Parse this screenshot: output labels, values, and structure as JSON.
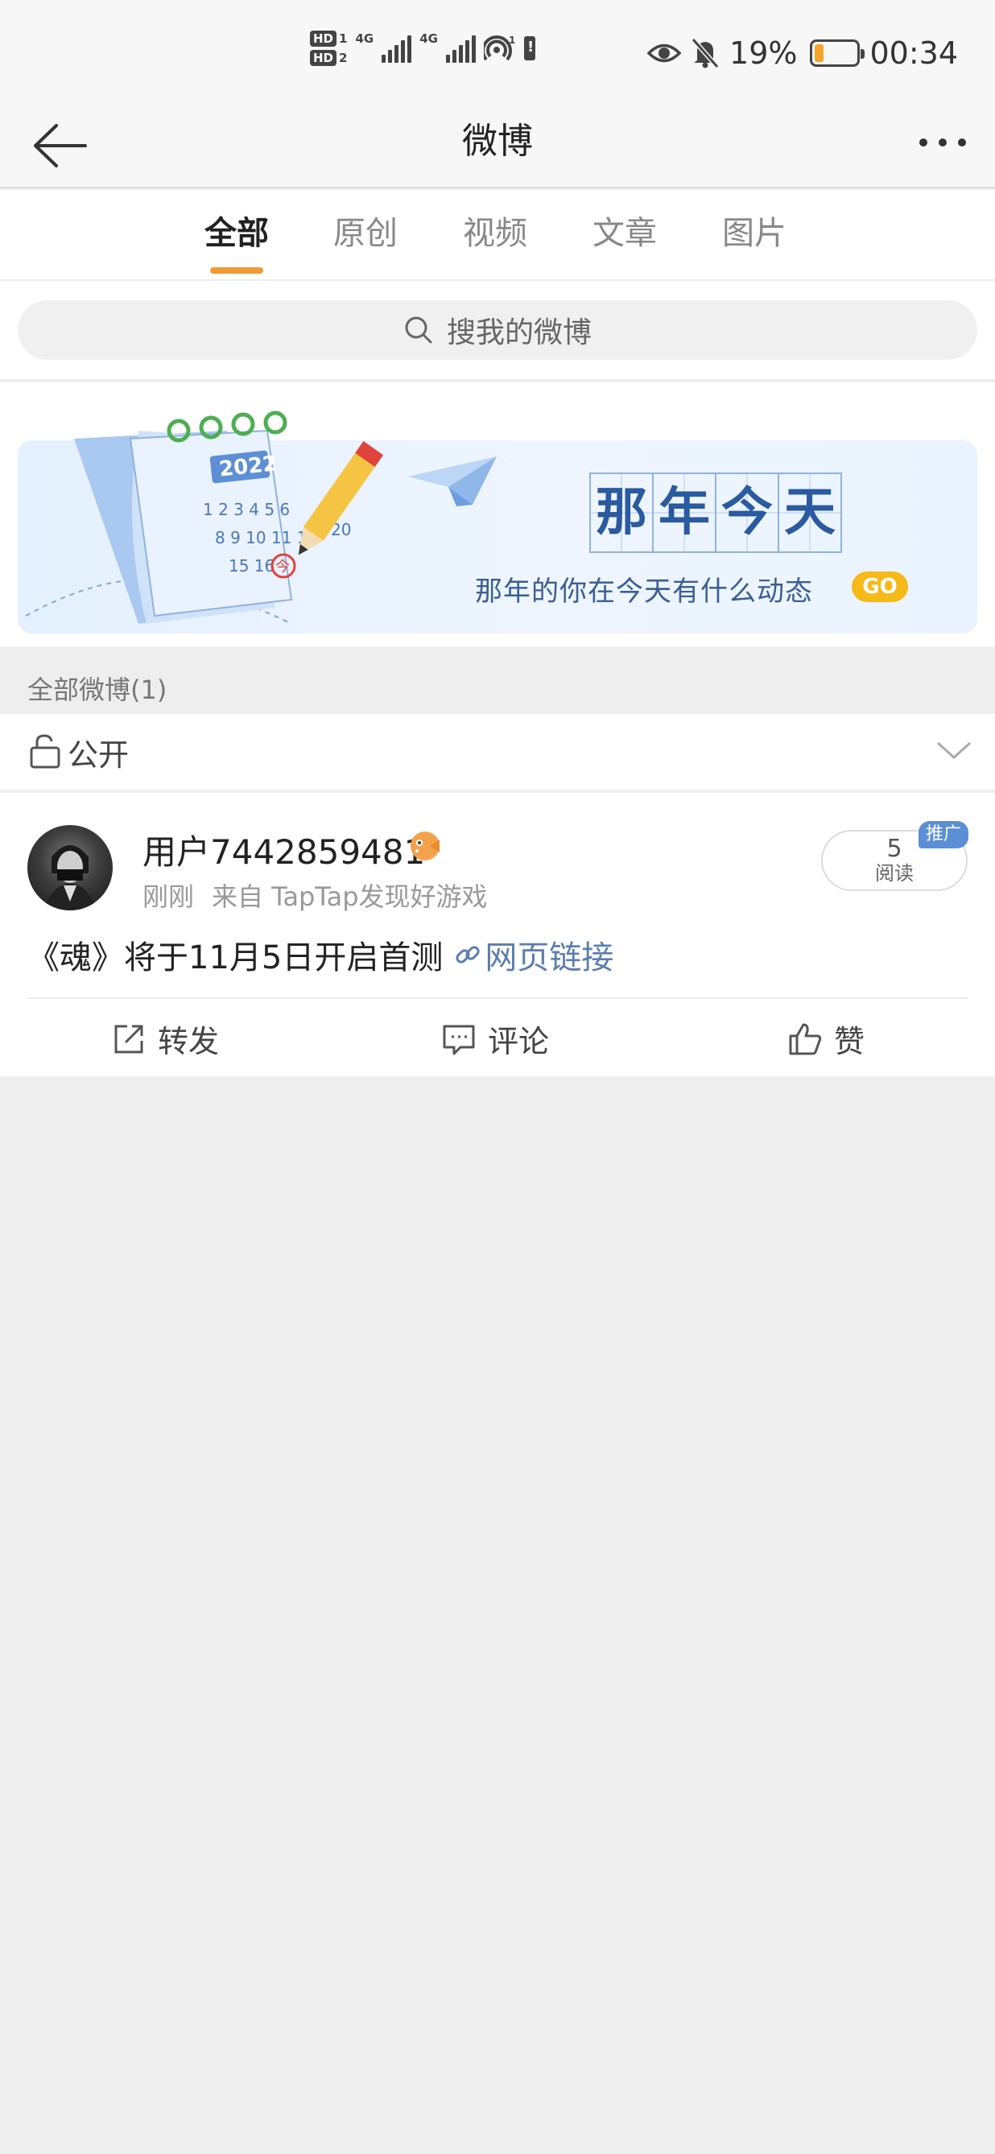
{
  "status_bar": {
    "sim1_label": "HD",
    "sim1_num": "1",
    "sim2_label": "HD",
    "sim2_num": "2",
    "net1": "4G",
    "net2": "4G",
    "wifi_badge": "1",
    "battery_percent": "19%",
    "time": "00:34",
    "battery_level": 0.19
  },
  "nav": {
    "title": "微博"
  },
  "tabs": [
    {
      "label": "全部",
      "active": true
    },
    {
      "label": "原创",
      "active": false
    },
    {
      "label": "视频",
      "active": false
    },
    {
      "label": "文章",
      "active": false
    },
    {
      "label": "图片",
      "active": false
    }
  ],
  "search": {
    "placeholder": "搜我的微博"
  },
  "banner": {
    "title_chars": [
      "那",
      "年",
      "今",
      "天"
    ],
    "subtitle": "那年的你在今天有什么动态",
    "go_label": "GO",
    "calendar_year": "2022",
    "calendar_today": "今"
  },
  "section": {
    "label": "全部微博(1)"
  },
  "visibility": {
    "label": "公开"
  },
  "post": {
    "username": "用户7442859481",
    "time": "刚刚",
    "source": "来自 TapTap发现好游戏",
    "read_count": "5",
    "read_label": "阅读",
    "promo_badge": "推广",
    "text": "《魂》将于11月5日开启首测",
    "link_text": "网页链接",
    "actions": {
      "repost": "转发",
      "comment": "评论",
      "like": "赞"
    }
  },
  "colors": {
    "accent": "#f09a37",
    "link": "#5b7eaf",
    "promo": "#5a8fd6",
    "go_button": "#f5b918",
    "banner_text": "#2a5aa0"
  }
}
